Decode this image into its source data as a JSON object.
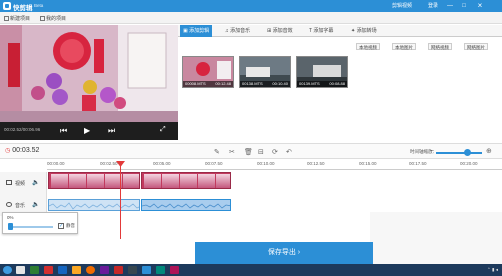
{
  "window": {
    "app_name": "快剪辑",
    "beta": "Beta",
    "quick_video": "剪辑视频",
    "login": "登录",
    "minimize": "—",
    "maximize": "□",
    "close": "×"
  },
  "menu": {
    "new_project": "新建项目",
    "my_projects": "我的项目"
  },
  "player": {
    "time": "00:02.52/00:06.96"
  },
  "tabs": [
    {
      "label": "添加剪辑"
    },
    {
      "label": "添加音乐"
    },
    {
      "label": "添加音效"
    },
    {
      "label": "添加字幕"
    },
    {
      "label": "添加转场"
    }
  ],
  "tools": {
    "local_video": "本地视频",
    "local_image": "本地图片",
    "web_video": "网络视频",
    "web_image": "网络图片"
  },
  "clips": [
    {
      "name": "00008.MTS",
      "duration": "00:12.48"
    },
    {
      "name": "00138.MTS",
      "duration": "00:10.40"
    },
    {
      "name": "00139.MTS",
      "duration": "00:08.88"
    }
  ],
  "timeline": {
    "current_time": "00:03.52",
    "zoom_label": "时间轴缩放：",
    "ruler": [
      "00:00.00",
      "00:02.50",
      "00:05.00",
      "00:07.50",
      "00:10.00",
      "00:12.50",
      "00:15.00",
      "00:17.50",
      "00:20.00"
    ],
    "video_track": "视频",
    "audio_track": "音乐"
  },
  "volume_popup": {
    "percent": "0%",
    "mute_label": "静音",
    "volume": 0
  },
  "export": {
    "label": "保存导出"
  },
  "colors": {
    "accent": "#2c8fd6",
    "video_clip": "#c23a5e",
    "playhead": "#e23a3a"
  }
}
